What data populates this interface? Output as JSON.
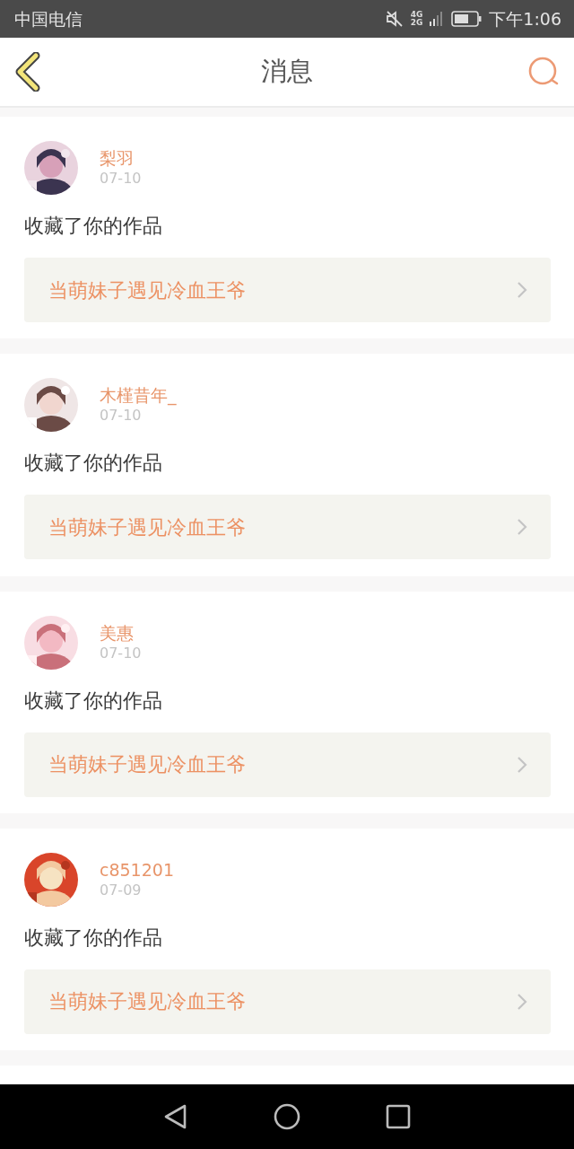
{
  "status_bar": {
    "carrier": "中国电信",
    "network_top": "4G",
    "network_bottom": "2G",
    "time": "下午1:06"
  },
  "header": {
    "title": "消息"
  },
  "messages": [
    {
      "user": "梨羽",
      "date": "07-10",
      "action": "收藏了你的作品",
      "work": "当萌妹子遇见冷血王爷"
    },
    {
      "user": "木槿昔年_",
      "date": "07-10",
      "action": "收藏了你的作品",
      "work": "当萌妹子遇见冷血王爷"
    },
    {
      "user": "美惠",
      "date": "07-10",
      "action": "收藏了你的作品",
      "work": "当萌妹子遇见冷血王爷"
    },
    {
      "user": "c851201",
      "date": "07-09",
      "action": "收藏了你的作品",
      "work": "当萌妹子遇见冷血王爷"
    }
  ]
}
